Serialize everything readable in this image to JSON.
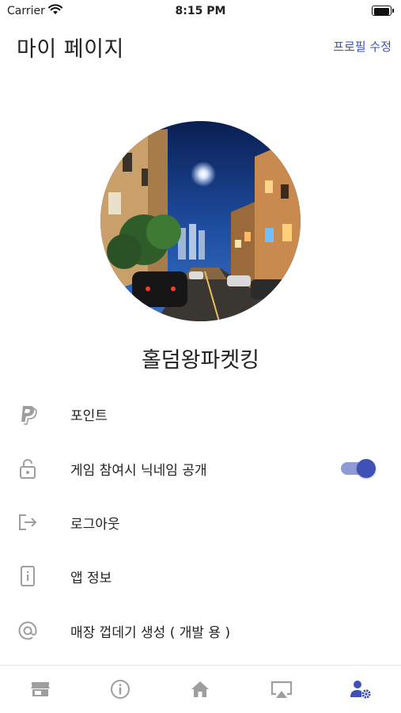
{
  "status_bar": {
    "carrier": "Carrier",
    "time": "8:15 PM"
  },
  "header": {
    "title": "마이 페이지",
    "edit_profile": "프로필 수정"
  },
  "profile": {
    "nickname": "홀덤왕파켓킹"
  },
  "menu": [
    {
      "label": "포인트",
      "icon": "paypal-icon"
    },
    {
      "label": "게임 참여시 닉네임 공개",
      "icon": "lock-open-icon",
      "toggle_on": true
    },
    {
      "label": "로그아웃",
      "icon": "logout-icon"
    },
    {
      "label": "앱 정보",
      "icon": "app-info-icon"
    },
    {
      "label": "매장 껍데기 생성 ( 개발 용 )",
      "icon": "at-sign-icon"
    }
  ],
  "tab_bar": {
    "tabs": [
      "store-icon",
      "info-icon",
      "home-icon",
      "airplay-icon",
      "user-settings-icon"
    ],
    "active_index": 4
  },
  "colors": {
    "accent": "#3f51b5",
    "toggle_track": "#8f9bd6",
    "icon_inactive": "#9e9e9e"
  }
}
